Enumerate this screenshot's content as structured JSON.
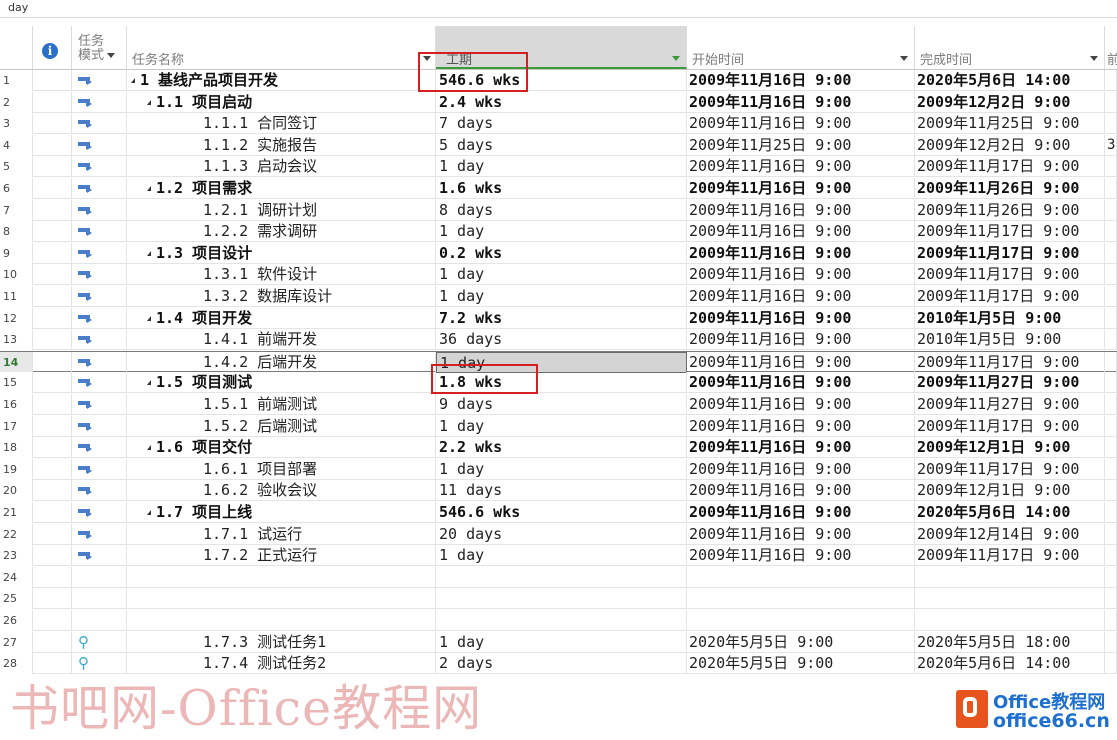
{
  "top_field": "day",
  "headers": {
    "mode_line1": "任务",
    "mode_line2": "模式",
    "name": "任务名称",
    "duration": "工期",
    "start": "开始时间",
    "finish": "完成时间",
    "predecessor": "前"
  },
  "rows": [
    {
      "id": "1",
      "name": "1 基线产品项目开发",
      "duration": "546.6 wks",
      "start": "2009年11月16日 9:00",
      "finish": "2020年5月6日 14:00",
      "pred": ""
    },
    {
      "id": "2",
      "name": "1.1 项目启动",
      "duration": "2.4 wks",
      "start": "2009年11月16日 9:00",
      "finish": "2009年12月2日 9:00",
      "pred": ""
    },
    {
      "id": "3",
      "name": "1.1.1 合同签订",
      "duration": "7 days",
      "start": "2009年11月16日 9:00",
      "finish": "2009年11月25日 9:00",
      "pred": ""
    },
    {
      "id": "4",
      "name": "1.1.2 实施报告",
      "duration": "5 days",
      "start": "2009年11月25日 9:00",
      "finish": "2009年12月2日 9:00",
      "pred": "3"
    },
    {
      "id": "5",
      "name": "1.1.3 启动会议",
      "duration": "1 day",
      "start": "2009年11月16日 9:00",
      "finish": "2009年11月17日 9:00",
      "pred": ""
    },
    {
      "id": "6",
      "name": "1.2 项目需求",
      "duration": "1.6 wks",
      "start": "2009年11月16日 9:00",
      "finish": "2009年11月26日 9:00",
      "pred": ""
    },
    {
      "id": "7",
      "name": "1.2.1 调研计划",
      "duration": "8 days",
      "start": "2009年11月16日 9:00",
      "finish": "2009年11月26日 9:00",
      "pred": ""
    },
    {
      "id": "8",
      "name": "1.2.2 需求调研",
      "duration": "1 day",
      "start": "2009年11月16日 9:00",
      "finish": "2009年11月17日 9:00",
      "pred": ""
    },
    {
      "id": "9",
      "name": "1.3 项目设计",
      "duration": "0.2 wks",
      "start": "2009年11月16日 9:00",
      "finish": "2009年11月17日 9:00",
      "pred": ""
    },
    {
      "id": "10",
      "name": "1.3.1 软件设计",
      "duration": "1 day",
      "start": "2009年11月16日 9:00",
      "finish": "2009年11月17日 9:00",
      "pred": ""
    },
    {
      "id": "11",
      "name": "1.3.2 数据库设计",
      "duration": "1 day",
      "start": "2009年11月16日 9:00",
      "finish": "2009年11月17日 9:00",
      "pred": ""
    },
    {
      "id": "12",
      "name": "1.4 项目开发",
      "duration": "7.2 wks",
      "start": "2009年11月16日 9:00",
      "finish": "2010年1月5日 9:00",
      "pred": ""
    },
    {
      "id": "13",
      "name": "1.4.1 前端开发",
      "duration": "36 days",
      "start": "2009年11月16日 9:00",
      "finish": "2010年1月5日 9:00",
      "pred": ""
    },
    {
      "id": "14",
      "name": "1.4.2 后端开发",
      "duration": "1 day",
      "start": "2009年11月16日 9:00",
      "finish": "2009年11月17日 9:00",
      "pred": ""
    },
    {
      "id": "15",
      "name": "1.5 项目测试",
      "duration": "1.8 wks",
      "start": "2009年11月16日 9:00",
      "finish": "2009年11月27日 9:00",
      "pred": ""
    },
    {
      "id": "16",
      "name": "1.5.1 前端测试",
      "duration": "9 days",
      "start": "2009年11月16日 9:00",
      "finish": "2009年11月27日 9:00",
      "pred": ""
    },
    {
      "id": "17",
      "name": "1.5.2 后端测试",
      "duration": "1 day",
      "start": "2009年11月16日 9:00",
      "finish": "2009年11月17日 9:00",
      "pred": ""
    },
    {
      "id": "18",
      "name": "1.6 项目交付",
      "duration": "2.2 wks",
      "start": "2009年11月16日 9:00",
      "finish": "2009年12月1日 9:00",
      "pred": ""
    },
    {
      "id": "19",
      "name": "1.6.1 项目部署",
      "duration": "1 day",
      "start": "2009年11月16日 9:00",
      "finish": "2009年11月17日 9:00",
      "pred": ""
    },
    {
      "id": "20",
      "name": "1.6.2 验收会议",
      "duration": "11 days",
      "start": "2009年11月16日 9:00",
      "finish": "2009年12月1日 9:00",
      "pred": ""
    },
    {
      "id": "21",
      "name": "1.7 项目上线",
      "duration": "546.6 wks",
      "start": "2009年11月16日 9:00",
      "finish": "2020年5月6日 14:00",
      "pred": ""
    },
    {
      "id": "22",
      "name": "1.7.1 试运行",
      "duration": "20 days",
      "start": "2009年11月16日 9:00",
      "finish": "2009年12月14日 9:00",
      "pred": ""
    },
    {
      "id": "23",
      "name": "1.7.2 正式运行",
      "duration": "1 day",
      "start": "2009年11月16日 9:00",
      "finish": "2009年11月17日 9:00",
      "pred": ""
    },
    {
      "id": "24",
      "name": "",
      "duration": "",
      "start": "",
      "finish": "",
      "pred": ""
    },
    {
      "id": "25",
      "name": "",
      "duration": "",
      "start": "",
      "finish": "",
      "pred": ""
    },
    {
      "id": "26",
      "name": "",
      "duration": "",
      "start": "",
      "finish": "",
      "pred": ""
    },
    {
      "id": "27",
      "name": "1.7.3 测试任务1",
      "duration": "1 day",
      "start": "2020年5月5日 9:00",
      "finish": "2020年5月5日 18:00",
      "pred": ""
    },
    {
      "id": "28",
      "name": "1.7.4 测试任务2",
      "duration": "2 days",
      "start": "2020年5月5日 9:00",
      "finish": "2020年5月6日 14:00",
      "pred": ""
    }
  ],
  "row_meta": [
    {
      "level": 0,
      "summary": true,
      "mode": "auto"
    },
    {
      "level": 1,
      "summary": true,
      "mode": "auto"
    },
    {
      "level": 2,
      "summary": false,
      "mode": "auto"
    },
    {
      "level": 2,
      "summary": false,
      "mode": "auto"
    },
    {
      "level": 2,
      "summary": false,
      "mode": "auto"
    },
    {
      "level": 1,
      "summary": true,
      "mode": "auto"
    },
    {
      "level": 2,
      "summary": false,
      "mode": "auto"
    },
    {
      "level": 2,
      "summary": false,
      "mode": "auto"
    },
    {
      "level": 1,
      "summary": true,
      "mode": "auto"
    },
    {
      "level": 2,
      "summary": false,
      "mode": "auto"
    },
    {
      "level": 2,
      "summary": false,
      "mode": "auto"
    },
    {
      "level": 1,
      "summary": true,
      "mode": "auto"
    },
    {
      "level": 2,
      "summary": false,
      "mode": "auto"
    },
    {
      "level": 2,
      "summary": false,
      "mode": "auto",
      "selected": true
    },
    {
      "level": 1,
      "summary": true,
      "mode": "auto"
    },
    {
      "level": 2,
      "summary": false,
      "mode": "auto"
    },
    {
      "level": 2,
      "summary": false,
      "mode": "auto"
    },
    {
      "level": 1,
      "summary": true,
      "mode": "auto"
    },
    {
      "level": 2,
      "summary": false,
      "mode": "auto"
    },
    {
      "level": 2,
      "summary": false,
      "mode": "auto"
    },
    {
      "level": 1,
      "summary": true,
      "mode": "auto"
    },
    {
      "level": 2,
      "summary": false,
      "mode": "auto"
    },
    {
      "level": 2,
      "summary": false,
      "mode": "auto"
    },
    {
      "level": 0,
      "summary": false,
      "mode": "none"
    },
    {
      "level": 0,
      "summary": false,
      "mode": "none"
    },
    {
      "level": 0,
      "summary": false,
      "mode": "none"
    },
    {
      "level": 2,
      "summary": false,
      "mode": "manual"
    },
    {
      "level": 2,
      "summary": false,
      "mode": "manual"
    }
  ],
  "icons": {
    "info": "info-icon",
    "auto_mode": "auto-scheduled-task-icon",
    "manual_mode": "manually-scheduled-pin-icon"
  },
  "colors": {
    "highlight_box": "#d42020",
    "selected_column_accent": "#3c9a3c",
    "info_icon": "#2a6fc9"
  },
  "watermark": "书吧网-Office教程网",
  "logo": {
    "line1": "Office教程网",
    "line2": "office66.cn"
  }
}
